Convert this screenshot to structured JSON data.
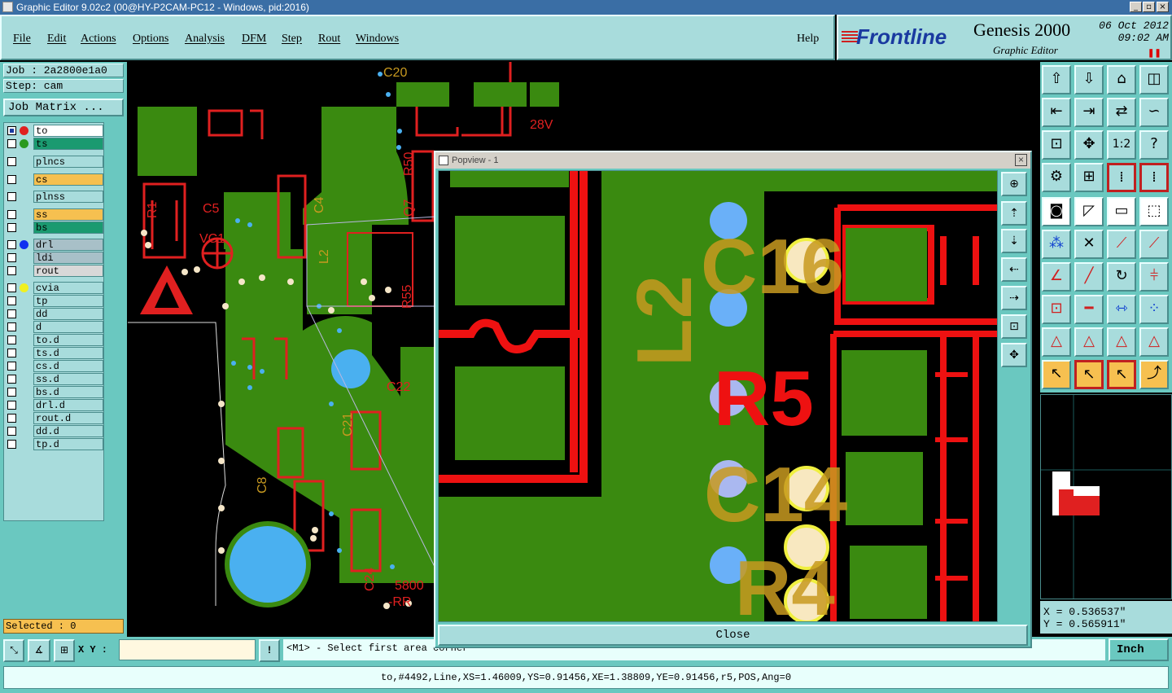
{
  "window": {
    "title": "Graphic Editor 9.02c2 (00@HY-P2CAM-PC12 - Windows, pid:2016)"
  },
  "menu": [
    "File",
    "Edit",
    "Actions",
    "Options",
    "Analysis",
    "DFM",
    "Step",
    "Rout",
    "Windows"
  ],
  "help_label": "Help",
  "brand": {
    "logo": "Frontline",
    "product": "Genesis 2000",
    "subtitle": "Graphic Editor",
    "date": "06 Oct 2012",
    "time": "09:02 AM"
  },
  "job": {
    "job_line": "Job : 2a2800e1a0",
    "step_line": "Step: cam",
    "matrix_button": "Job Matrix ..."
  },
  "layers": [
    {
      "name": "to",
      "color": "#ffffff",
      "dot": "#e02020",
      "selected": true
    },
    {
      "name": "ts",
      "color": "#1a9a70",
      "dot": "#2a9a20"
    },
    {
      "name": "plncs",
      "color": "#a8dcdc"
    },
    {
      "name": "cs",
      "color": "#f6c050"
    },
    {
      "name": "plnss",
      "color": "#a8dcdc"
    },
    {
      "name": "ss",
      "color": "#f6c050"
    },
    {
      "name": "bs",
      "color": "#1a9a70"
    },
    {
      "name": "drl",
      "color": "#a8c0c8",
      "dot": "#1030f0"
    },
    {
      "name": "ldi",
      "color": "#a8c0c8"
    },
    {
      "name": "rout",
      "color": "#d8d8d8"
    },
    {
      "name": "cvia",
      "color": "#a8dcdc",
      "dot": "#f0f020"
    },
    {
      "name": "tp",
      "color": "#a8dcdc"
    },
    {
      "name": "dd",
      "color": "#a8dcdc"
    },
    {
      "name": "d",
      "color": "#a8dcdc"
    },
    {
      "name": "to.d",
      "color": "#a8dcdc"
    },
    {
      "name": "ts.d",
      "color": "#a8dcdc"
    },
    {
      "name": "cs.d",
      "color": "#a8dcdc"
    },
    {
      "name": "ss.d",
      "color": "#a8dcdc"
    },
    {
      "name": "bs.d",
      "color": "#a8dcdc"
    },
    {
      "name": "drl.d",
      "color": "#a8dcdc"
    },
    {
      "name": "rout.d",
      "color": "#a8dcdc"
    },
    {
      "name": "dd.d",
      "color": "#a8dcdc"
    },
    {
      "name": "tp.d",
      "color": "#a8dcdc"
    }
  ],
  "selected_text": "Selected : 0",
  "coords": {
    "x": "X = 0.536537\"",
    "y": "Y = 0.565911\""
  },
  "xy_label": "X Y :",
  "prompt": "<M1> - Select first area corner",
  "units": "Inch",
  "status": "to,#4492,Line,XS=1.46009,YS=0.91456,XE=1.38809,YE=0.91456,r5,POS,Ang=0",
  "popview": {
    "title": "Popview - 1",
    "close_label": "Close"
  },
  "pcb_labels": [
    "C20",
    "28V",
    "R50",
    "Q7",
    "C4",
    "R1",
    "C5",
    "VC1",
    "L2",
    "R55",
    "C22",
    "C21",
    "C8",
    "C24",
    "5800",
    "-RR"
  ],
  "popview_labels": [
    "C16",
    "L2",
    "R5",
    "C14",
    "R4"
  ]
}
